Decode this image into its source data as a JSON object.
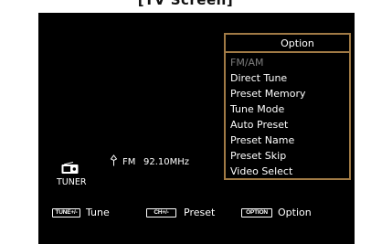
{
  "caption": "[TV Screen]",
  "option_menu": {
    "title": "Option",
    "items": [
      {
        "label": "FM/AM",
        "dimmed": true
      },
      {
        "label": "Direct Tune",
        "dimmed": false
      },
      {
        "label": "Preset Memory",
        "dimmed": false
      },
      {
        "label": "Tune Mode",
        "dimmed": false
      },
      {
        "label": "Auto Preset",
        "dimmed": false
      },
      {
        "label": "Preset Name",
        "dimmed": false
      },
      {
        "label": "Preset Skip",
        "dimmed": false
      },
      {
        "label": "Video Select",
        "dimmed": false
      }
    ]
  },
  "status": {
    "source_icon": "radio-icon",
    "source_label": "TUNER",
    "antenna_icon": "antenna-icon",
    "band": "FM",
    "frequency": "92.10MHz"
  },
  "key_guide": [
    {
      "key": "TUNE+/-",
      "action": "Tune"
    },
    {
      "key": "CH+/-",
      "action": "Preset"
    },
    {
      "key": "OPTION",
      "action": "Option"
    }
  ],
  "colors": {
    "screen_background": "#000000",
    "panel_border": "#a07a45",
    "text": "#ffffff",
    "dimmed_text": "#7d7d7d"
  }
}
